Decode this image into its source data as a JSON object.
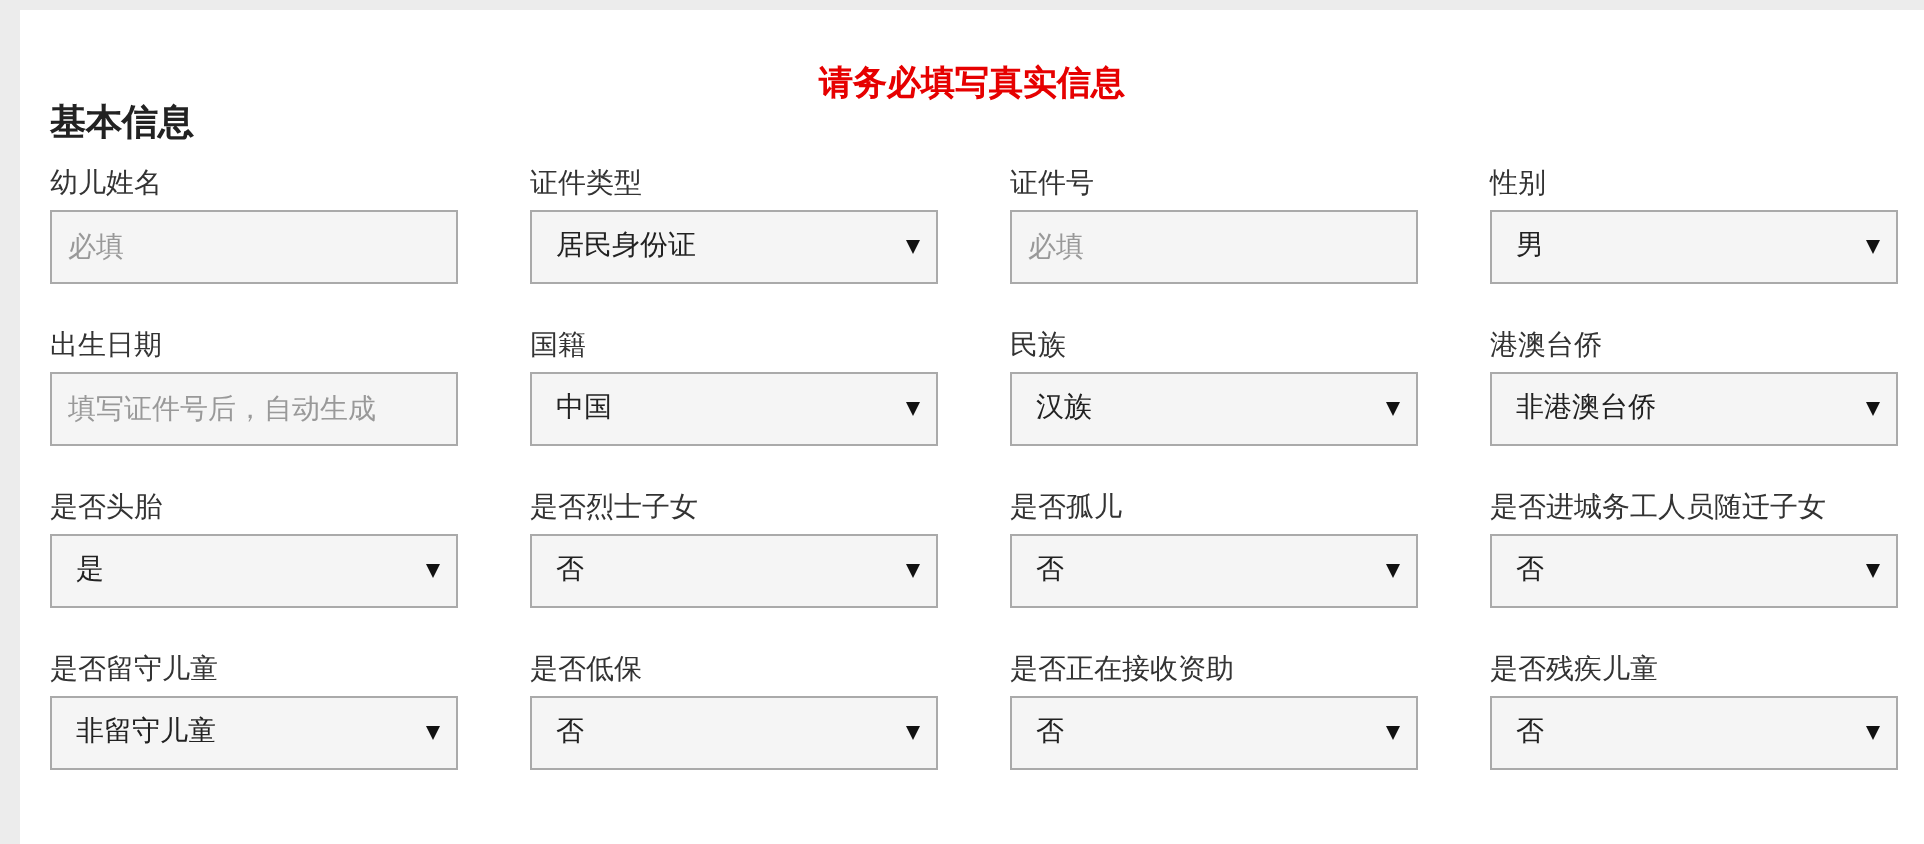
{
  "notice": "请务必填写真实信息",
  "section_title": "基本信息",
  "fields": [
    {
      "label": "幼儿姓名",
      "kind": "text",
      "placeholder": "必填"
    },
    {
      "label": "证件类型",
      "kind": "select",
      "value": "居民身份证"
    },
    {
      "label": "证件号",
      "kind": "text",
      "placeholder": "必填"
    },
    {
      "label": "性别",
      "kind": "select",
      "value": "男"
    },
    {
      "label": "出生日期",
      "kind": "text",
      "placeholder": "填写证件号后，自动生成"
    },
    {
      "label": "国籍",
      "kind": "select",
      "value": "中国"
    },
    {
      "label": "民族",
      "kind": "select",
      "value": "汉族"
    },
    {
      "label": "港澳台侨",
      "kind": "select",
      "value": "非港澳台侨"
    },
    {
      "label": "是否头胎",
      "kind": "select",
      "value": "是"
    },
    {
      "label": "是否烈士子女",
      "kind": "select",
      "value": "否"
    },
    {
      "label": "是否孤儿",
      "kind": "select",
      "value": "否"
    },
    {
      "label": "是否进城务工人员随迁子女",
      "kind": "select",
      "value": "否"
    },
    {
      "label": "是否留守儿童",
      "kind": "select",
      "value": "非留守儿童"
    },
    {
      "label": "是否低保",
      "kind": "select",
      "value": "否"
    },
    {
      "label": "是否正在接收资助",
      "kind": "select",
      "value": "否"
    },
    {
      "label": "是否残疾儿童",
      "kind": "select",
      "value": "否"
    }
  ]
}
